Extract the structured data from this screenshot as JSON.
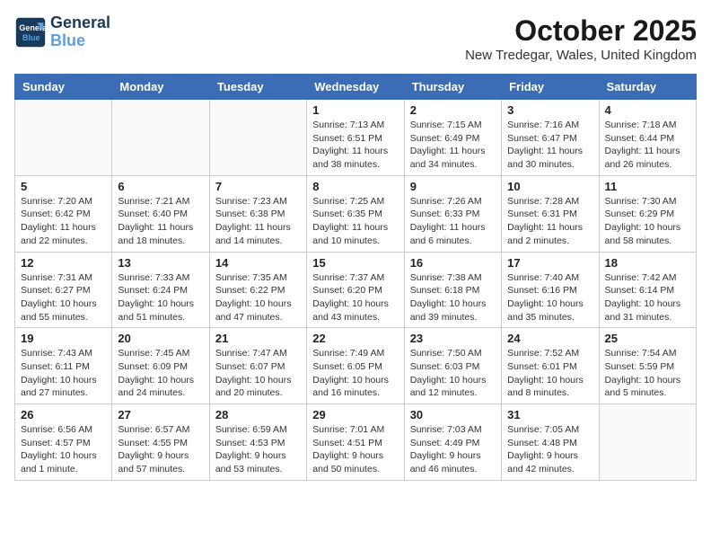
{
  "logo": {
    "line1": "General",
    "line2": "Blue"
  },
  "title": "October 2025",
  "location": "New Tredegar, Wales, United Kingdom",
  "weekdays": [
    "Sunday",
    "Monday",
    "Tuesday",
    "Wednesday",
    "Thursday",
    "Friday",
    "Saturday"
  ],
  "weeks": [
    [
      {
        "day": "",
        "info": ""
      },
      {
        "day": "",
        "info": ""
      },
      {
        "day": "",
        "info": ""
      },
      {
        "day": "1",
        "info": "Sunrise: 7:13 AM\nSunset: 6:51 PM\nDaylight: 11 hours\nand 38 minutes."
      },
      {
        "day": "2",
        "info": "Sunrise: 7:15 AM\nSunset: 6:49 PM\nDaylight: 11 hours\nand 34 minutes."
      },
      {
        "day": "3",
        "info": "Sunrise: 7:16 AM\nSunset: 6:47 PM\nDaylight: 11 hours\nand 30 minutes."
      },
      {
        "day": "4",
        "info": "Sunrise: 7:18 AM\nSunset: 6:44 PM\nDaylight: 11 hours\nand 26 minutes."
      }
    ],
    [
      {
        "day": "5",
        "info": "Sunrise: 7:20 AM\nSunset: 6:42 PM\nDaylight: 11 hours\nand 22 minutes."
      },
      {
        "day": "6",
        "info": "Sunrise: 7:21 AM\nSunset: 6:40 PM\nDaylight: 11 hours\nand 18 minutes."
      },
      {
        "day": "7",
        "info": "Sunrise: 7:23 AM\nSunset: 6:38 PM\nDaylight: 11 hours\nand 14 minutes."
      },
      {
        "day": "8",
        "info": "Sunrise: 7:25 AM\nSunset: 6:35 PM\nDaylight: 11 hours\nand 10 minutes."
      },
      {
        "day": "9",
        "info": "Sunrise: 7:26 AM\nSunset: 6:33 PM\nDaylight: 11 hours\nand 6 minutes."
      },
      {
        "day": "10",
        "info": "Sunrise: 7:28 AM\nSunset: 6:31 PM\nDaylight: 11 hours\nand 2 minutes."
      },
      {
        "day": "11",
        "info": "Sunrise: 7:30 AM\nSunset: 6:29 PM\nDaylight: 10 hours\nand 58 minutes."
      }
    ],
    [
      {
        "day": "12",
        "info": "Sunrise: 7:31 AM\nSunset: 6:27 PM\nDaylight: 10 hours\nand 55 minutes."
      },
      {
        "day": "13",
        "info": "Sunrise: 7:33 AM\nSunset: 6:24 PM\nDaylight: 10 hours\nand 51 minutes."
      },
      {
        "day": "14",
        "info": "Sunrise: 7:35 AM\nSunset: 6:22 PM\nDaylight: 10 hours\nand 47 minutes."
      },
      {
        "day": "15",
        "info": "Sunrise: 7:37 AM\nSunset: 6:20 PM\nDaylight: 10 hours\nand 43 minutes."
      },
      {
        "day": "16",
        "info": "Sunrise: 7:38 AM\nSunset: 6:18 PM\nDaylight: 10 hours\nand 39 minutes."
      },
      {
        "day": "17",
        "info": "Sunrise: 7:40 AM\nSunset: 6:16 PM\nDaylight: 10 hours\nand 35 minutes."
      },
      {
        "day": "18",
        "info": "Sunrise: 7:42 AM\nSunset: 6:14 PM\nDaylight: 10 hours\nand 31 minutes."
      }
    ],
    [
      {
        "day": "19",
        "info": "Sunrise: 7:43 AM\nSunset: 6:11 PM\nDaylight: 10 hours\nand 27 minutes."
      },
      {
        "day": "20",
        "info": "Sunrise: 7:45 AM\nSunset: 6:09 PM\nDaylight: 10 hours\nand 24 minutes."
      },
      {
        "day": "21",
        "info": "Sunrise: 7:47 AM\nSunset: 6:07 PM\nDaylight: 10 hours\nand 20 minutes."
      },
      {
        "day": "22",
        "info": "Sunrise: 7:49 AM\nSunset: 6:05 PM\nDaylight: 10 hours\nand 16 minutes."
      },
      {
        "day": "23",
        "info": "Sunrise: 7:50 AM\nSunset: 6:03 PM\nDaylight: 10 hours\nand 12 minutes."
      },
      {
        "day": "24",
        "info": "Sunrise: 7:52 AM\nSunset: 6:01 PM\nDaylight: 10 hours\nand 8 minutes."
      },
      {
        "day": "25",
        "info": "Sunrise: 7:54 AM\nSunset: 5:59 PM\nDaylight: 10 hours\nand 5 minutes."
      }
    ],
    [
      {
        "day": "26",
        "info": "Sunrise: 6:56 AM\nSunset: 4:57 PM\nDaylight: 10 hours\nand 1 minute."
      },
      {
        "day": "27",
        "info": "Sunrise: 6:57 AM\nSunset: 4:55 PM\nDaylight: 9 hours\nand 57 minutes."
      },
      {
        "day": "28",
        "info": "Sunrise: 6:59 AM\nSunset: 4:53 PM\nDaylight: 9 hours\nand 53 minutes."
      },
      {
        "day": "29",
        "info": "Sunrise: 7:01 AM\nSunset: 4:51 PM\nDaylight: 9 hours\nand 50 minutes."
      },
      {
        "day": "30",
        "info": "Sunrise: 7:03 AM\nSunset: 4:49 PM\nDaylight: 9 hours\nand 46 minutes."
      },
      {
        "day": "31",
        "info": "Sunrise: 7:05 AM\nSunset: 4:48 PM\nDaylight: 9 hours\nand 42 minutes."
      },
      {
        "day": "",
        "info": ""
      }
    ]
  ]
}
